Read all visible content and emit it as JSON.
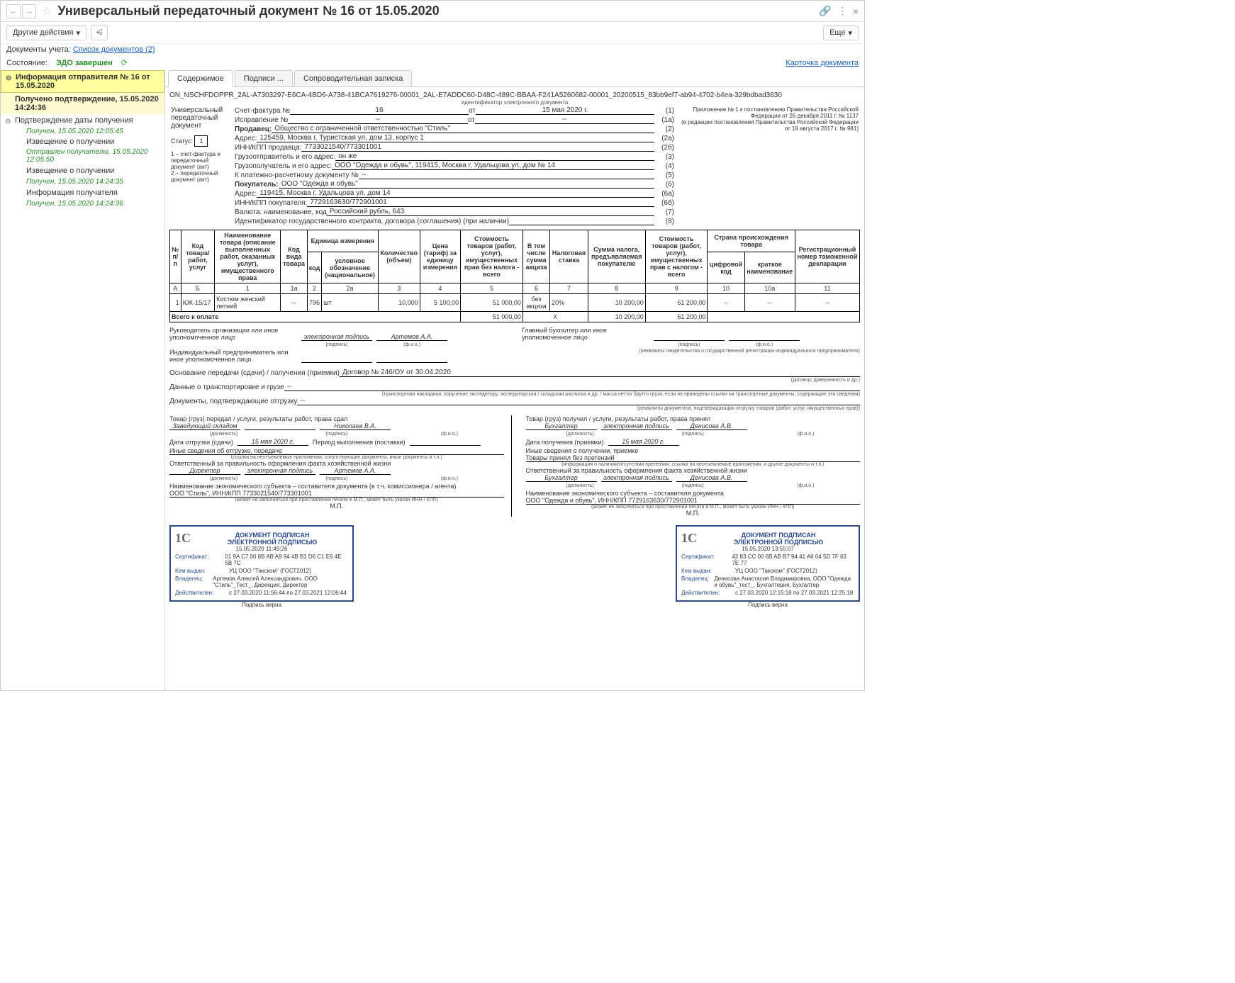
{
  "title": "Универсальный передаточный документ № 16 от 15.05.2020",
  "toolbar": {
    "other_actions": "Другие действия",
    "more": "Еще"
  },
  "meta": {
    "docs_label": "Документы учета:",
    "docs_link": "Список документов (2)"
  },
  "state": {
    "label": "Состояние:",
    "value": "ЭДО завершен",
    "card_link": "Карточка документа"
  },
  "sidebar": {
    "h1": "Информация отправителя № 16 от 15.05.2020",
    "confirm": "Получено подтверждение, 15.05.2020 14:24:36",
    "s1": "Подтверждение даты получения",
    "d1": "Получен, 15.05.2020 12:05:45",
    "s2": "Извещение о получении",
    "d2": "Отправлен получателю, 15.05.2020 12:05:50",
    "s3": "Извещение о получении",
    "d3": "Получен, 15.05.2020 14:24:35",
    "s4": "Информация получателя",
    "d4": "Получен, 15.05.2020 14:24:36"
  },
  "tabs": {
    "t1": "Содержимое",
    "t2": "Подписи ...",
    "t3": "Сопроводительная записка"
  },
  "doc_id": "ON_NSCHFDOPPR_2AL-A7303297-E6CA-4BD6-A738-41BCA7619276-00001_2AL-E7ADDC60-D48C-489C-BBAA-F241A5260682-00001_20200515_83bb9ef7-ab94-4702-b4ea-329bdbad3630",
  "doc_id_caption": "идентификатор электронного документа",
  "upd": {
    "title": "Универсальный передаточный документ",
    "status": "Статус:",
    "status_val": "1",
    "note1": "1 – счет-фактура и передаточный документ (акт)",
    "note2": "2 – передаточный документ (акт)"
  },
  "appendix": {
    "l1": "Приложение № 1 к постановлению Правительства Российской Федерации от 26 декабря 2011 г. № 1137",
    "l2": "(в редакции постановления Правительства Российской Федерации от 19 августа 2017 г. № 981)"
  },
  "invoice": {
    "sf": "Счет-фактура №",
    "sf_num": "16",
    "sf_ot": "от",
    "sf_date": "15 мая 2020 г.",
    "sf_p": "(1)",
    "corr": "Исправление №",
    "corr_num": "--",
    "corr_ot": "от",
    "corr_date": "--",
    "corr_p": "(1a)",
    "seller": "Продавец:",
    "seller_v": "Общество с ограниченной ответственностью \"Стиль\"",
    "seller_p": "(2)",
    "addr": "Адрес:",
    "addr_v": "125459, Москва г, Туристская ул, дом 13, корпус 1",
    "addr_p": "(2а)",
    "inn": "ИНН/КПП продавца:",
    "inn_v": "7733021540/773301001",
    "inn_p": "(2б)",
    "shipper": "Грузоотправитель и его адрес:",
    "shipper_v": "он же",
    "shipper_p": "(3)",
    "consignee": "Грузополучатель и его адрес:",
    "consignee_v": "ООО \"Одежда и обувь\", 119415, Москва г, Удальцова ул, дом № 14",
    "consignee_p": "(4)",
    "paydoc": "К платежно-расчетному документу №",
    "paydoc_v": "--",
    "paydoc_p": "(5)",
    "buyer": "Покупатель:",
    "buyer_v": "ООО \"Одежда и обувь\"",
    "buyer_p": "(6)",
    "baddr": "Адрес:",
    "baddr_v": "119415, Москва г, Удальцова ул, дом 14",
    "baddr_p": "(6а)",
    "binn": "ИНН/КПП покупателя:",
    "binn_v": "7729163630/772901001",
    "binn_p": "(6б)",
    "currency": "Валюта: наименование, код",
    "currency_v": "Российский рубль, 643",
    "currency_p": "(7)",
    "contract": "Идентификатор государственного контракта, договора (соглашения) (при наличии)",
    "contract_v": "",
    "contract_p": "(8)"
  },
  "grid": {
    "h_num": "№ п/п",
    "h_code": "Код товара/ работ, услуг",
    "h_name": "Наименование товара (описание выполненных работ, оказанных услуг), имущественного права",
    "h_typecode": "Код вида товара",
    "h_unit": "Единица измерения",
    "h_unit_code": "код",
    "h_unit_name": "условное обозначение (национальное)",
    "h_qty": "Количество (объем)",
    "h_price": "Цена (тариф) за единицу измерения",
    "h_cost": "Стоимость товаров (работ, услуг), имущественных прав без налога - всего",
    "h_excise": "В том числе сумма акциза",
    "h_rate": "Налоговая ставка",
    "h_tax": "Сумма налога, предъявляемая покупателю",
    "h_total": "Стоимость товаров (работ, услуг), имущественных прав с налогом - всего",
    "h_country": "Страна происхождения товара",
    "h_country_code": "цифровой код",
    "h_country_name": "краткое наименование",
    "h_decl": "Регистрационный номер таможенной декларации",
    "cA": "А",
    "cB": "Б",
    "c1": "1",
    "c1a": "1а",
    "c2": "2",
    "c2a": "2а",
    "c3": "3",
    "c4": "4",
    "c5": "5",
    "c6": "6",
    "c7": "7",
    "c8": "8",
    "c9": "9",
    "c10": "10",
    "c10a": "10а",
    "c11": "11",
    "row": {
      "num": "1",
      "code": "ЮК-15/17",
      "name": "Костюм женский летний",
      "typecode": "--",
      "ucode": "796",
      "uname": "шт",
      "qty": "10,000",
      "price": "5 100,00",
      "cost": "51 000,00",
      "excise": "без акциза",
      "rate": "20%",
      "tax": "10 200,00",
      "total": "61 200,00",
      "ccode": "--",
      "cname": "--",
      "decl": "--"
    },
    "total_label": "Всего к оплате",
    "total_cost": "51 000,00",
    "total_x": "X",
    "total_tax": "10 200,00",
    "total_sum": "61 200,00"
  },
  "sig": {
    "head": "Руководитель организации или иное уполномоченное лицо",
    "esig": "электронная подпись",
    "artemov": "Артемов А.А.",
    "podpis": "(подпись)",
    "fio": "(ф.и.о.)",
    "ip": "Индивидуальный предприниматель или иное уполномоченное лицо",
    "glavbuh": "Главный бухгалтер или иное уполномоченное лицо",
    "rekv": "(реквизиты свидетельства о государственной регистрации индивидуального предпринимателя)",
    "basis": "Основание передачи (сдачи) / получения (приемки)",
    "basis_v": "Договор № 246/ОУ от 30.04.2020",
    "basis_cap": "(договор; доверенность и др.)",
    "trans": "Данные о транспортировке и грузе",
    "trans_v": "--",
    "trans_cap": "(транспортная накладная, поручение экспедитору, экспедиторская / складская расписка и др. / масса нетто/ брутто груза, если не приведены ссылки на транспортные документы, содержащие эти сведения)",
    "confirm": "Документы, подтверждающие отгрузку",
    "confirm_v": "--",
    "confirm_cap": "(реквизиты документов, подтверждающих отгрузку товаров (работ, услуг, имущественных прав))",
    "left": {
      "t1": "Товар (груз) передал / услуги, результаты работ, права сдал",
      "pos": "Заведующий складом",
      "name": "Николаев В.А.",
      "date_l": "Дата отгрузки (сдачи)",
      "date_v": "15 мая 2020 г.",
      "period": "Период выполнения (поставки)",
      "info": "Иные сведения об отгрузке, передаче",
      "info_cap": "(ссылки на неотъемлемые приложения, сопутствующие документы, иные документы и т.п.)",
      "resp": "Ответственный за правильность оформления факта хозяйственной жизни",
      "resp_pos": "Директор",
      "resp_name": "Артемов А.А.",
      "org": "Наименование экономического субъекта – составителя документа (в т.ч. комиссионера / агента)",
      "org_v": "ООО \"Стиль\", ИНН/КПП 7733021540/773301001",
      "org_cap": "(может не заполняться при проставлении печати в М.П., может быть указан ИНН / КПП)",
      "mp": "М.П."
    },
    "right": {
      "t1": "Товар (груз) получил / услуги, результаты работ, права принял",
      "pos": "Бухгалтер",
      "name": "Денисова А.В.",
      "date_l": "Дата получения (приемки)",
      "date_v": "15 мая 2020 г.",
      "info": "Иные сведения о получении, приемке",
      "claim": "Товары принял без претензий",
      "claim_cap": "(информация о наличии/отсутствии претензии; ссылки на неотъемлемые приложения, и другие документы и т.п.)",
      "resp": "Ответственный за правильность оформления факта хозяйственной жизни",
      "resp_pos": "Бухгалтер",
      "resp_name": "Денисова А.В.",
      "org": "Наименование экономического субъекта – составителя документа",
      "org_v": "ООО \"Одежда и обувь\", ИНН/КПП 7729163630/772901001",
      "org_cap": "(может не заполняться при проставлении печати в М.П., может быть указан ИНН / КПП)",
      "mp": "М.П."
    },
    "pos_cap": "(должность)"
  },
  "stamp1": {
    "head1": "ДОКУМЕНТ ПОДПИСАН",
    "head2": "ЭЛЕКТРОННОЙ ПОДПИСЬЮ",
    "date": "15.05.2020 11:49:26",
    "cert_k": "Сертификат:",
    "cert_v": "01 9A C7 00 8B AB A9 94 4B B1 D6 C1 E6 4E 5B 7C",
    "issuer_k": "Кем выдан:",
    "issuer_v": "УЦ ООО \"Такском\" (ГОСТ2012)",
    "owner_k": "Владелец:",
    "owner_v": "Артемов Алексей Александрович, ООО \"Стиль\"_Тест_, Дирекция, Директор",
    "valid_k": "Действителен:",
    "valid_v": "с 27.03.2020 11:56:44 по 27.03.2021 12:06:44",
    "verna": "Подпись верна"
  },
  "stamp2": {
    "head1": "ДОКУМЕНТ ПОДПИСАН",
    "head2": "ЭЛЕКТРОННОЙ ПОДПИСЬЮ",
    "date": "15.05.2020 13:55:07",
    "cert_k": "Сертификат:",
    "cert_v": "42 83 CC 00 6B AB B7 94 41 A6 04 5D 7F 63 7E 77",
    "issuer_k": "Кем выдан:",
    "issuer_v": "УЦ ООО \"Такском\" (ГОСТ2012)",
    "owner_k": "Владелец:",
    "owner_v": "Денисова Анастасия Владимировна, ООО \"Одежда и обувь\"_тест_, Бухгалтерия, Бухгалтер",
    "valid_k": "Действителен:",
    "valid_v": "с 27.03.2020 12:15:18 по 27.03.2021 12:25:18",
    "verna": "Подпись верна"
  }
}
